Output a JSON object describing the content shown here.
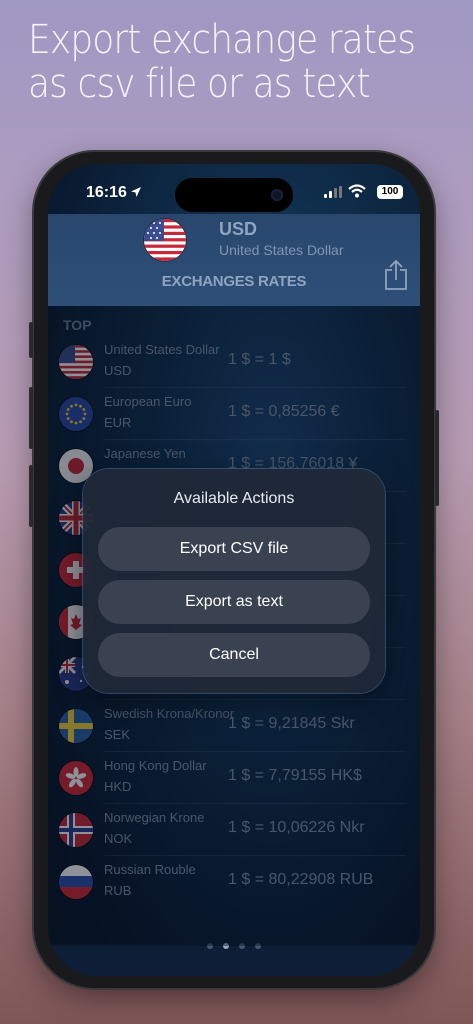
{
  "headline": {
    "line1": "Export exchange rates",
    "line2": "as csv file or as text"
  },
  "status_bar": {
    "time": "16:16",
    "battery": "100"
  },
  "header": {
    "code": "USD",
    "name": "United States Dollar",
    "title": "EXCHANGES RATES"
  },
  "section": "TOP",
  "rows": [
    {
      "name": "United States Dollar",
      "code": "USD",
      "rate": "1 $ = 1 $",
      "flag": "us-flag-icon"
    },
    {
      "name": "European Euro",
      "code": "EUR",
      "rate": "1 $ = 0,85256 €",
      "flag": "eu-flag-icon"
    },
    {
      "name": "Japanese Yen",
      "code": "",
      "rate": "1 $ = 156,76018 ¥",
      "flag": "jp-flag-icon"
    },
    {
      "name": "",
      "code": "",
      "rate": "",
      "flag": "gb-flag-icon"
    },
    {
      "name": "",
      "code": "",
      "rate": "",
      "flag": "ch-flag-icon"
    },
    {
      "name": "",
      "code": "",
      "rate": "",
      "flag": "ca-flag-icon"
    },
    {
      "name": "",
      "code": "",
      "rate": "",
      "flag": "au-flag-icon"
    },
    {
      "name": "Swedish Krona/Kronor",
      "code": "SEK",
      "rate": "1 $ = 9,21845 Skr",
      "flag": "se-flag-icon"
    },
    {
      "name": "Hong Kong Dollar",
      "code": "HKD",
      "rate": "1 $ = 7,79155 HK$",
      "flag": "hk-flag-icon"
    },
    {
      "name": "Norwegian Krone",
      "code": "NOK",
      "rate": "1 $ = 10,06226 Nkr",
      "flag": "no-flag-icon"
    },
    {
      "name": "Russian Rouble",
      "code": "RUB",
      "rate": "1 $ = 80,22908 RUB",
      "flag": "ru-flag-icon"
    }
  ],
  "dialog": {
    "title": "Available Actions",
    "export_csv": "Export CSV file",
    "export_text": "Export as text",
    "cancel": "Cancel"
  },
  "page_indicator": {
    "count": 4,
    "current": 2
  }
}
